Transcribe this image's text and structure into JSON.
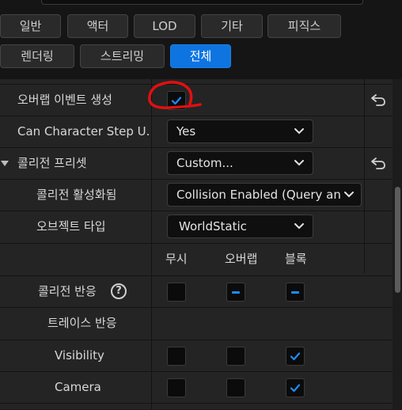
{
  "category_tabs": {
    "row1": [
      "일반",
      "액터",
      "LOD",
      "기타",
      "피직스"
    ],
    "row2": [
      "렌더링",
      "스트리밍",
      "전체"
    ],
    "active": "전체",
    "active_color": "#0e74e0"
  },
  "properties": {
    "generate_overlap_events": {
      "label": "오버랩 이벤트 생성",
      "checked": true,
      "annotation_color": "#e01010"
    },
    "can_character_step_up": {
      "label": "Can Character Step U...",
      "value": "Yes"
    },
    "collision_presets": {
      "label": "콜리전 프리셋",
      "value": "Custom..."
    },
    "collision_enabled": {
      "label": "콜리전 활성화됨",
      "value": "Collision Enabled (Query an"
    },
    "object_type": {
      "label": "오브젝트 타입",
      "value": "WorldStatic"
    }
  },
  "response_table": {
    "columns": [
      "무시",
      "오버랩",
      "블록"
    ],
    "collision_response": {
      "label": "콜리전 반응",
      "help_icon": "?",
      "states": [
        "none",
        "mixed",
        "mixed"
      ]
    },
    "trace_response": {
      "label": "트레이스 반응"
    },
    "rows": [
      {
        "label": "Visibility",
        "states": [
          "unchecked",
          "unchecked",
          "checked"
        ]
      },
      {
        "label": "Camera",
        "states": [
          "unchecked",
          "unchecked",
          "checked"
        ]
      }
    ]
  },
  "icons": {
    "reset": "reset-to-default-icon",
    "expand": "collapse-arrow-icon",
    "dropdown": "chevron-down-icon",
    "check": "checkmark-icon"
  },
  "colors": {
    "check": "#1e8cff"
  }
}
